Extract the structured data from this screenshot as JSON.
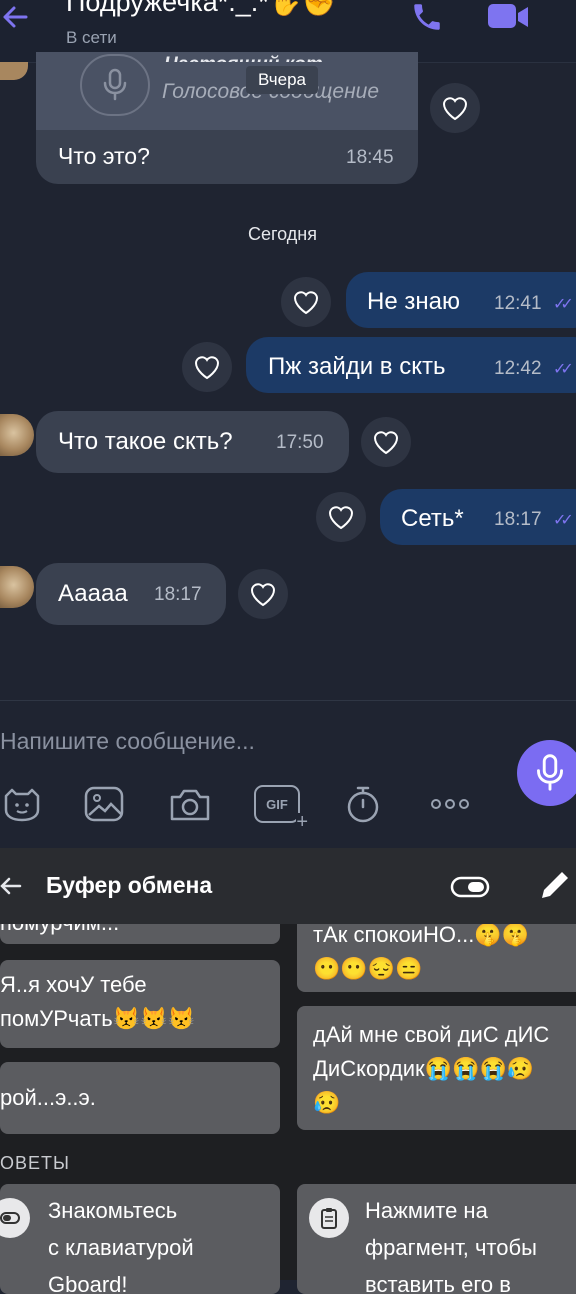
{
  "header": {
    "title": "Подружечка*._.*✋✊",
    "status": "В сети"
  },
  "voice_card": {
    "label": "Голосовое сообщение",
    "partial_text": "Настоящий кот"
  },
  "date_badge_prev": "Вчера",
  "messages_prev": {
    "text": "Что это?",
    "time": "18:45"
  },
  "date_today": "Сегодня",
  "messages": [
    {
      "dir": "out",
      "text": "Не знаю",
      "time": "12:41"
    },
    {
      "dir": "out",
      "text": "Пж зайди в скть",
      "time": "12:42"
    },
    {
      "dir": "in",
      "text": "Что такое скть?",
      "time": "17:50"
    },
    {
      "dir": "out",
      "text": "Сеть*",
      "time": "18:17"
    },
    {
      "dir": "in",
      "text": "Ааааа",
      "time": "18:17"
    }
  ],
  "input": {
    "placeholder": "Напишите сообщение..."
  },
  "toolbar": {
    "gif_label": "GIF"
  },
  "keyboard": {
    "title": "Буфер обмена",
    "section_tips": "ОВЕТЫ",
    "clips_left": [
      "помурчим...",
      "Я..я хочУ тебе",
      "помУРчать😾😾😾",
      "рой...э..э."
    ],
    "clips_right": [
      "тАк спокоиНО...🤫🤫",
      "😶😶😔😑",
      "дАй мне свой диС дИС",
      "ДиСкордик😭😭😭😥",
      "😥"
    ],
    "tips": [
      {
        "line1": "Знакомьтесь",
        "line2": "с клавиатурой",
        "line3": "Gboard!"
      },
      {
        "line1": "Нажмите на",
        "line2": "фрагмент, чтобы",
        "line3": "вставить его в"
      }
    ]
  },
  "colors": {
    "accent": "#7b6cf2",
    "bubble_out": "#1c3a66",
    "bubble_in": "#3a4150",
    "bg": "#1f2431"
  }
}
